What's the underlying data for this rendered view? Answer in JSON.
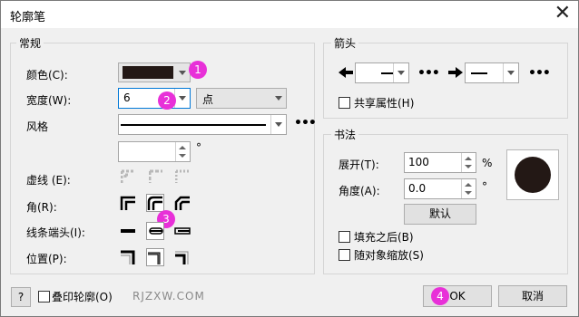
{
  "window": {
    "title": "轮廓笔"
  },
  "general": {
    "group_label": "常规",
    "color_label": "颜色(C):",
    "color_value": "#231815",
    "width_label": "宽度(W):",
    "width_value": "6",
    "unit_value": "点",
    "style_label": "风格",
    "degree_symbol": "°",
    "dashed_label": "虚线 (E):",
    "corner_label": "角(R):",
    "cap_label": "线条端头(I):",
    "position_label": "位置(P):"
  },
  "arrows": {
    "group_label": "箭头",
    "share_label": "共享属性(H)"
  },
  "calligraphy": {
    "group_label": "书法",
    "stretch_label": "展开(T):",
    "stretch_value": "100",
    "percent_symbol": "%",
    "angle_label": "角度(A):",
    "angle_value": "0.0",
    "degree_symbol": "°",
    "default_button": "默认",
    "fill_behind_label": "填充之后(B)",
    "scale_with_label": "随对象缩放(S)"
  },
  "footer": {
    "help_button": "?",
    "overprint_label": "叠印轮廓(O)",
    "watermark": "RJZXW.COM",
    "ok_button": "OK",
    "cancel_button": "取消"
  },
  "badges": [
    "1",
    "2",
    "3",
    "4"
  ],
  "colors": {
    "accent_badge": "#e830d8",
    "input_focus": "#0078d7"
  }
}
